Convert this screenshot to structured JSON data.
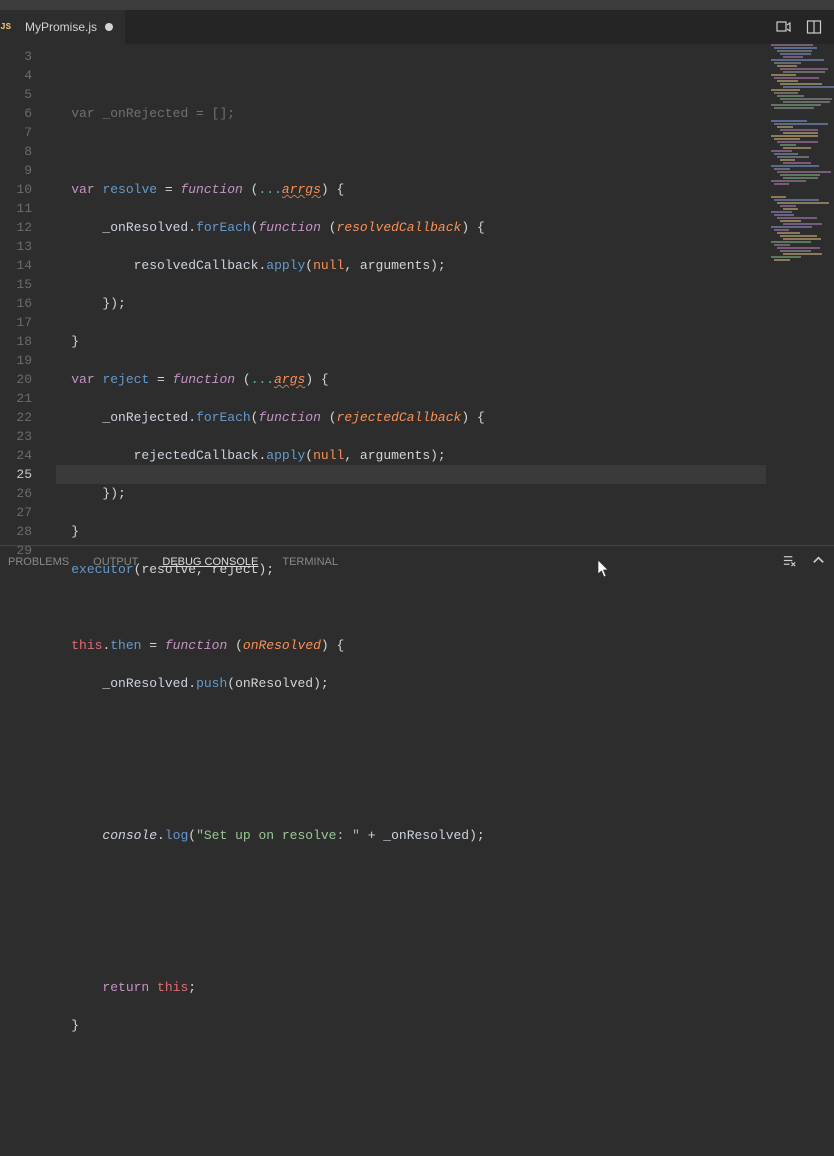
{
  "tab": {
    "filename": "MyPromise.js"
  },
  "gutter": {
    "start": 3,
    "end": 29
  },
  "panel": {
    "tabs": [
      "PROBLEMS",
      "OUTPUT",
      "DEBUG CONSOLE",
      "TERMINAL"
    ],
    "active": "DEBUG CONSOLE"
  },
  "currentLine": 25,
  "code": {
    "l3": {
      "indent": "    ",
      "t1": "var",
      "t2": " _onRejected = [];"
    },
    "l4": {
      "indent": ""
    },
    "l5": {
      "indent": "    ",
      "var": "var",
      "sp": " ",
      "name": "resolve",
      "eq": " = ",
      "fn": "function",
      "op": " (",
      "spr": "...",
      "arg": "arrgs",
      "cl": ") {"
    },
    "l6": {
      "indent": "        ",
      "id": "_onResolved",
      "dot": ".",
      "call": "forEach",
      "op": "(",
      "fn": "function",
      "sp": " (",
      "param": "resolvedCallback",
      "cl": ") {"
    },
    "l7": {
      "indent": "            ",
      "id": "resolvedCallback",
      "dot": ".",
      "call": "apply",
      "op": "(",
      "nul": "null",
      "comma": ", arguments);"
    },
    "l8": {
      "indent": "        ",
      "cl": "});"
    },
    "l9": {
      "indent": "    ",
      "cl": "}"
    },
    "l10": {
      "indent": "    ",
      "var": "var",
      "sp": " ",
      "name": "reject",
      "eq": " = ",
      "fn": "function",
      "op": " (",
      "spr": "...",
      "arg": "args",
      "cl": ") {"
    },
    "l11": {
      "indent": "        ",
      "id": "_onRejected",
      "dot": ".",
      "call": "forEach",
      "op": "(",
      "fn": "function",
      "sp": " (",
      "param": "rejectedCallback",
      "cl": ") {"
    },
    "l12": {
      "indent": "            ",
      "id": "rejectedCallback",
      "dot": ".",
      "call": "apply",
      "op": "(",
      "nul": "null",
      "comma": ", arguments);"
    },
    "l13": {
      "indent": "        ",
      "cl": "});"
    },
    "l14": {
      "indent": "    ",
      "cl": "}"
    },
    "l15": {
      "indent": "    ",
      "call": "executor",
      "args": "(resolve, reject);"
    },
    "l16": {
      "indent": ""
    },
    "l17": {
      "indent": "    ",
      "this": "this",
      "dot": ".",
      "prop": "then",
      "eq": " = ",
      "fn": "function",
      "op": " (",
      "param": "onResolved",
      "cl": ") {"
    },
    "l18": {
      "indent": "        ",
      "id": "_onResolved",
      "dot": ".",
      "call": "push",
      "args": "(onResolved);"
    },
    "l19": {
      "indent": ""
    },
    "l20": {
      "indent": ""
    },
    "l21": {
      "indent": ""
    },
    "l22": {
      "indent": "        ",
      "con": "console",
      "dot": ".",
      "call": "log",
      "op": "(",
      "str": "\"Set up on resolve: \"",
      "plus": " + ",
      "id": "_onResolved",
      "cl": ");"
    },
    "l23": {
      "indent": ""
    },
    "l24": {
      "indent": ""
    },
    "l25": {
      "indent": ""
    },
    "l26": {
      "indent": "        ",
      "ret": "return",
      "sp": " ",
      "this": "this",
      "semi": ";"
    },
    "l27": {
      "indent": "    ",
      "cl": "}"
    },
    "l28": {
      "indent": ""
    },
    "l29": {
      "indent": ""
    }
  }
}
